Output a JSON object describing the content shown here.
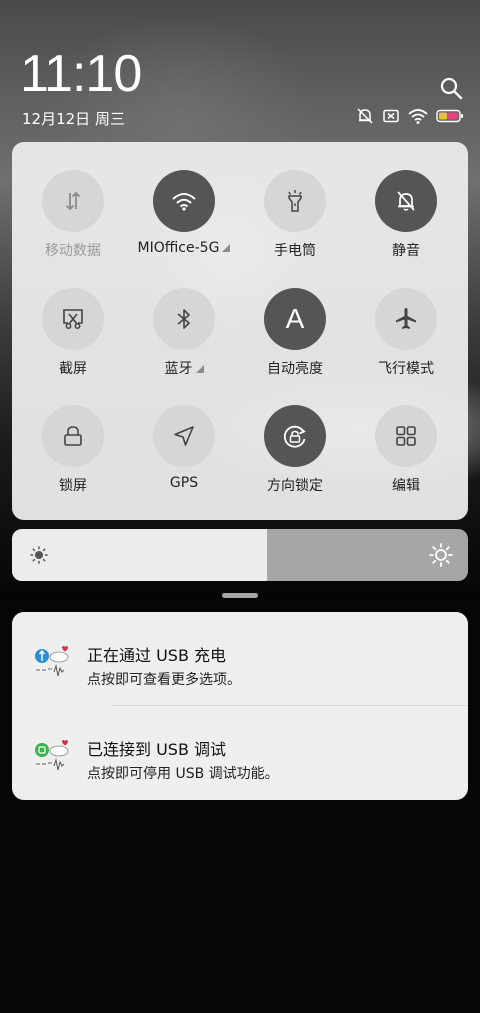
{
  "status": {
    "time": "11:10",
    "date": "12月12日 周三",
    "icons": [
      "mute-bell-icon",
      "sim-none-icon",
      "wifi-icon",
      "battery-icon"
    ]
  },
  "quick_settings": [
    {
      "label": "移动数据",
      "icon": "data-arrows-icon",
      "active": false,
      "disabled": true,
      "has_more": false
    },
    {
      "label": "MIOffice-5G",
      "icon": "wifi-icon",
      "active": true,
      "disabled": false,
      "has_more": true
    },
    {
      "label": "手电筒",
      "icon": "flashlight-icon",
      "active": false,
      "disabled": false,
      "has_more": false
    },
    {
      "label": "静音",
      "icon": "bell-off-icon",
      "active": true,
      "disabled": false,
      "has_more": false
    },
    {
      "label": "截屏",
      "icon": "screenshot-icon",
      "active": false,
      "disabled": false,
      "has_more": false
    },
    {
      "label": "蓝牙",
      "icon": "bluetooth-icon",
      "active": false,
      "disabled": false,
      "has_more": true
    },
    {
      "label": "自动亮度",
      "icon": "auto-brightness-icon",
      "glyph": "A",
      "active": true,
      "disabled": false,
      "has_more": false
    },
    {
      "label": "飞行模式",
      "icon": "airplane-icon",
      "active": false,
      "disabled": false,
      "has_more": false
    },
    {
      "label": "锁屏",
      "icon": "lock-icon",
      "active": false,
      "disabled": false,
      "has_more": false
    },
    {
      "label": "GPS",
      "icon": "gps-icon",
      "active": false,
      "disabled": false,
      "has_more": false
    },
    {
      "label": "方向锁定",
      "icon": "rotation-lock-icon",
      "active": true,
      "disabled": false,
      "has_more": false
    },
    {
      "label": "编辑",
      "icon": "grid-edit-icon",
      "active": false,
      "disabled": false,
      "has_more": false
    }
  ],
  "brightness": {
    "level": 0.56
  },
  "notifications": [
    {
      "title": "正在通过 USB 充电",
      "body": "点按即可查看更多选项。",
      "icon": "usb-charging-app-icon",
      "accent": "#2a8fd6"
    },
    {
      "title": "已连接到 USB 调试",
      "body": "点按即可停用 USB 调试功能。",
      "icon": "android-debug-app-icon",
      "accent": "#3cb24a"
    }
  ],
  "colors": {
    "panel": "#ececec",
    "tile_on": "#555555",
    "tile_off": "#d6d6d6"
  }
}
